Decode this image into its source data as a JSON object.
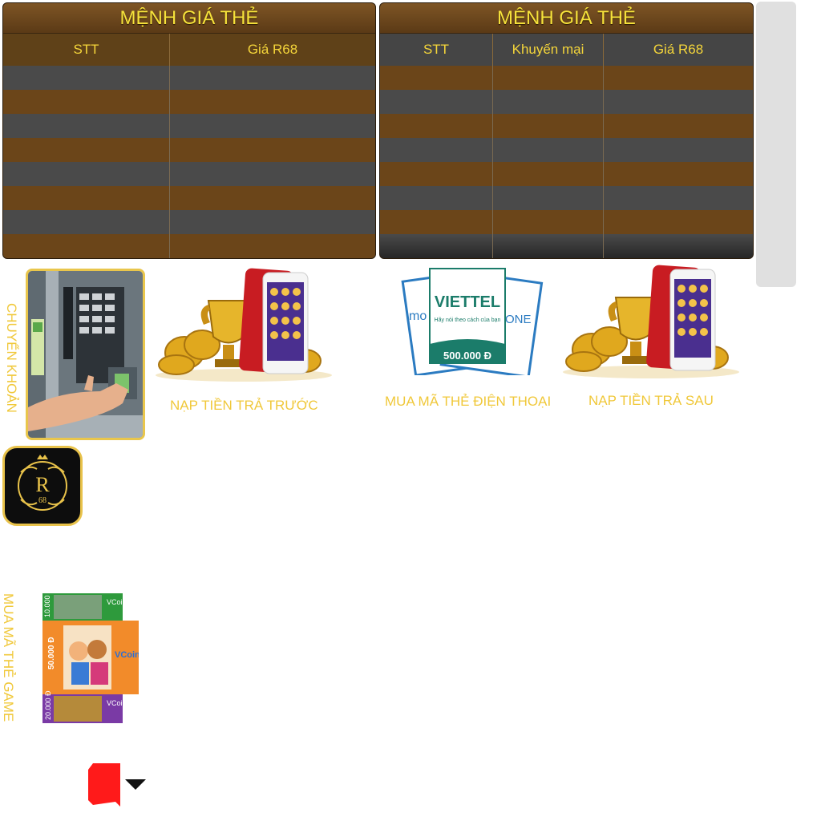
{
  "left_table": {
    "title": "MỆNH GIÁ THẺ",
    "columns": [
      "STT",
      "Giá R68"
    ],
    "row_count": 8
  },
  "right_table": {
    "title": "MỆNH GIÁ THẺ",
    "columns": [
      "STT",
      "Khuyến mại",
      "Giá R68"
    ],
    "row_count": 8
  },
  "options": {
    "bank_transfer": "CHUYỂN KHOẢN",
    "prepaid": "NẠP TIỀN TRẢ TRƯỚC",
    "phone_card": "MUA MÃ THẺ ĐIỆN THOẠI",
    "postpaid": "NẠP TIỀN TRẢ SAU",
    "game_card": "MUA MÃ THẺ GAME"
  },
  "phone_card_art": {
    "brand": "VIETTEL",
    "slogan": "Hãy nói theo cách của bạn",
    "value": "500.000 Đ",
    "back_left": "mo",
    "back_right": "ONE"
  },
  "game_card_art": {
    "brand": "VCoin",
    "values": [
      "10.000 Đ",
      "50.000 Đ",
      "20.000 Đ"
    ]
  },
  "logo": {
    "letter": "R",
    "number": "68"
  },
  "colors": {
    "gold": "#f0c83a",
    "title_yellow": "#f6e23b",
    "row_brown": "#6b4519",
    "row_grey": "#4a4a4a",
    "viettel_green": "#1b7c6a"
  }
}
